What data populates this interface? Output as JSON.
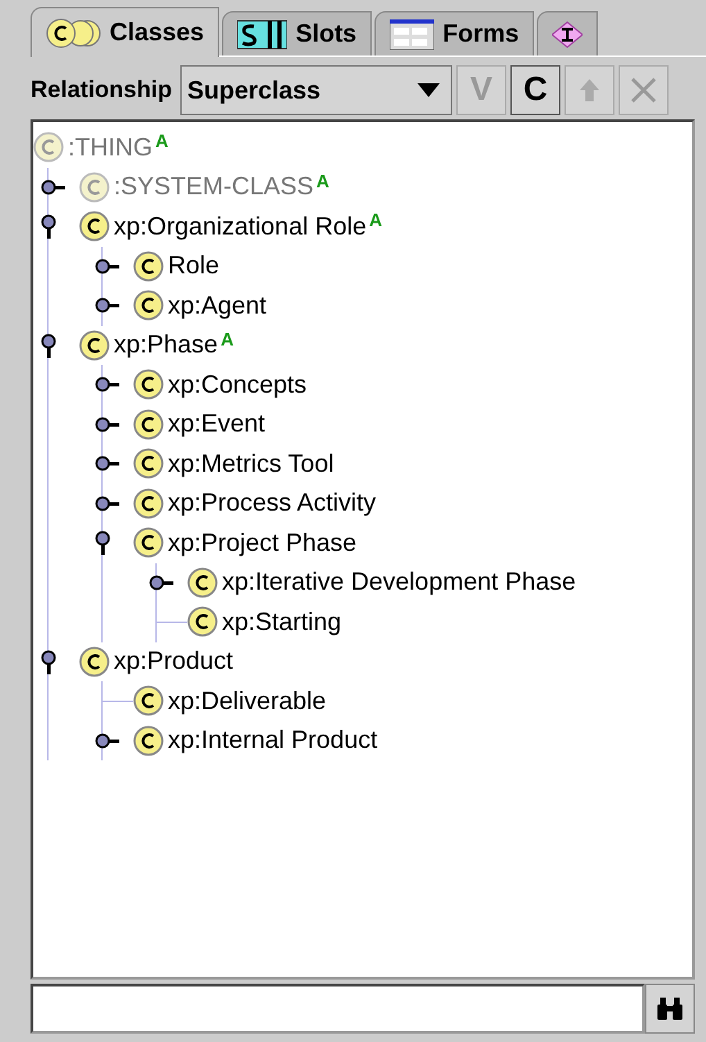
{
  "tabs": [
    {
      "label": "Classes",
      "kind": "classes",
      "selected": true
    },
    {
      "label": "Slots",
      "kind": "slots",
      "selected": false
    },
    {
      "label": "Forms",
      "kind": "forms",
      "selected": false
    },
    {
      "kind": "instances",
      "selected": false
    }
  ],
  "toolbar": {
    "label": "Relationship",
    "dropdown": "Superclass",
    "buttons": [
      {
        "kind": "text",
        "text": "V",
        "disabled": true
      },
      {
        "kind": "text",
        "text": "C",
        "disabled": false
      },
      {
        "kind": "up",
        "disabled": true
      },
      {
        "kind": "delete",
        "disabled": true
      }
    ]
  },
  "tree": [
    {
      "label": ":THING",
      "system": true,
      "badge": "A",
      "children": [
        {
          "label": ":SYSTEM-CLASS",
          "system": true,
          "badge": "A",
          "kind": "collapsed"
        },
        {
          "label": "xp:Organizational Role",
          "system": false,
          "badge": "A",
          "kind": "expanded",
          "children": [
            {
              "label": "Role",
              "system": false,
              "kind": "collapsed"
            },
            {
              "label": "xp:Agent",
              "system": false,
              "kind": "collapsed"
            }
          ]
        },
        {
          "label": "xp:Phase",
          "system": false,
          "badge": "A",
          "kind": "expanded",
          "children": [
            {
              "label": "xp:Concepts",
              "system": false,
              "kind": "collapsed"
            },
            {
              "label": "xp:Event",
              "system": false,
              "kind": "collapsed"
            },
            {
              "label": "xp:Metrics Tool",
              "system": false,
              "kind": "collapsed"
            },
            {
              "label": "xp:Process Activity",
              "system": false,
              "kind": "collapsed"
            },
            {
              "label": "xp:Project Phase",
              "system": false,
              "kind": "expanded",
              "children": [
                {
                  "label": "xp:Iterative Development Phase",
                  "system": false,
                  "kind": "collapsed"
                },
                {
                  "label": "xp:Starting",
                  "system": false,
                  "kind": "leaf"
                }
              ]
            }
          ]
        },
        {
          "label": "xp:Product",
          "system": false,
          "kind": "expanded",
          "children": [
            {
              "label": "xp:Deliverable",
              "system": false,
              "kind": "leaf"
            },
            {
              "label": "xp:Internal Product",
              "system": false,
              "kind": "collapsed"
            }
          ]
        }
      ]
    }
  ]
}
